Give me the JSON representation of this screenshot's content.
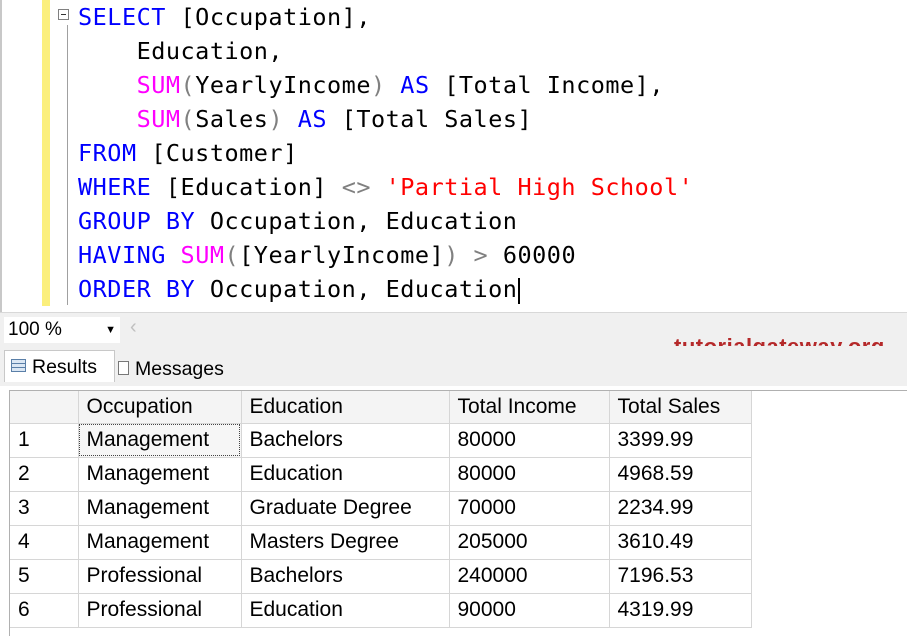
{
  "editor": {
    "lines": [
      [
        {
          "t": "SELECT",
          "c": "kw"
        },
        {
          "t": " [Occupation],",
          "c": ""
        }
      ],
      [
        {
          "t": "    Education,",
          "c": ""
        }
      ],
      [
        {
          "t": "    ",
          "c": ""
        },
        {
          "t": "SUM",
          "c": "fn"
        },
        {
          "t": "(",
          "c": "op"
        },
        {
          "t": "YearlyIncome",
          "c": ""
        },
        {
          "t": ")",
          "c": "op"
        },
        {
          "t": " ",
          "c": ""
        },
        {
          "t": "AS",
          "c": "kw"
        },
        {
          "t": " [Total Income],",
          "c": ""
        }
      ],
      [
        {
          "t": "    ",
          "c": ""
        },
        {
          "t": "SUM",
          "c": "fn"
        },
        {
          "t": "(",
          "c": "op"
        },
        {
          "t": "Sales",
          "c": ""
        },
        {
          "t": ")",
          "c": "op"
        },
        {
          "t": " ",
          "c": ""
        },
        {
          "t": "AS",
          "c": "kw"
        },
        {
          "t": " [Total Sales]",
          "c": ""
        }
      ],
      [
        {
          "t": "FROM",
          "c": "kw"
        },
        {
          "t": " [Customer]",
          "c": ""
        }
      ],
      [
        {
          "t": "WHERE",
          "c": "kw"
        },
        {
          "t": " [Education] ",
          "c": ""
        },
        {
          "t": "<>",
          "c": "op"
        },
        {
          "t": " ",
          "c": ""
        },
        {
          "t": "'Partial High School'",
          "c": "str"
        }
      ],
      [
        {
          "t": "GROUP BY",
          "c": "kw"
        },
        {
          "t": " Occupation, Education",
          "c": ""
        }
      ],
      [
        {
          "t": "HAVING",
          "c": "kw"
        },
        {
          "t": " ",
          "c": ""
        },
        {
          "t": "SUM",
          "c": "fn"
        },
        {
          "t": "(",
          "c": "op"
        },
        {
          "t": "[YearlyIncome]",
          "c": ""
        },
        {
          "t": ")",
          "c": "op"
        },
        {
          "t": " ",
          "c": ""
        },
        {
          "t": ">",
          "c": "op"
        },
        {
          "t": " 60000",
          "c": ""
        }
      ],
      [
        {
          "t": "ORDER BY",
          "c": "kw"
        },
        {
          "t": " Occupation, Education",
          "c": ""
        }
      ]
    ]
  },
  "zoom": {
    "value": "100 %"
  },
  "brand": "tutorialgateway.org",
  "tabs": {
    "results": "Results",
    "messages": "Messages"
  },
  "grid": {
    "columns": [
      "",
      "Occupation",
      "Education",
      "Total Income",
      "Total Sales"
    ],
    "rows": [
      [
        "1",
        "Management",
        "Bachelors",
        "80000",
        "3399.99"
      ],
      [
        "2",
        "Management",
        "Education",
        "80000",
        "4968.59"
      ],
      [
        "3",
        "Management",
        "Graduate Degree",
        "70000",
        "2234.99"
      ],
      [
        "4",
        "Management",
        "Masters Degree",
        "205000",
        "3610.49"
      ],
      [
        "5",
        "Professional",
        "Bachelors",
        "240000",
        "7196.53"
      ],
      [
        "6",
        "Professional",
        "Education",
        "90000",
        "4319.99"
      ]
    ]
  },
  "colors": {
    "keyword": "#0000ff",
    "function": "#ff00ff",
    "operator": "#808080",
    "string": "#ff0000",
    "brand": "#b5292a",
    "gutter": "#fbef7c"
  }
}
